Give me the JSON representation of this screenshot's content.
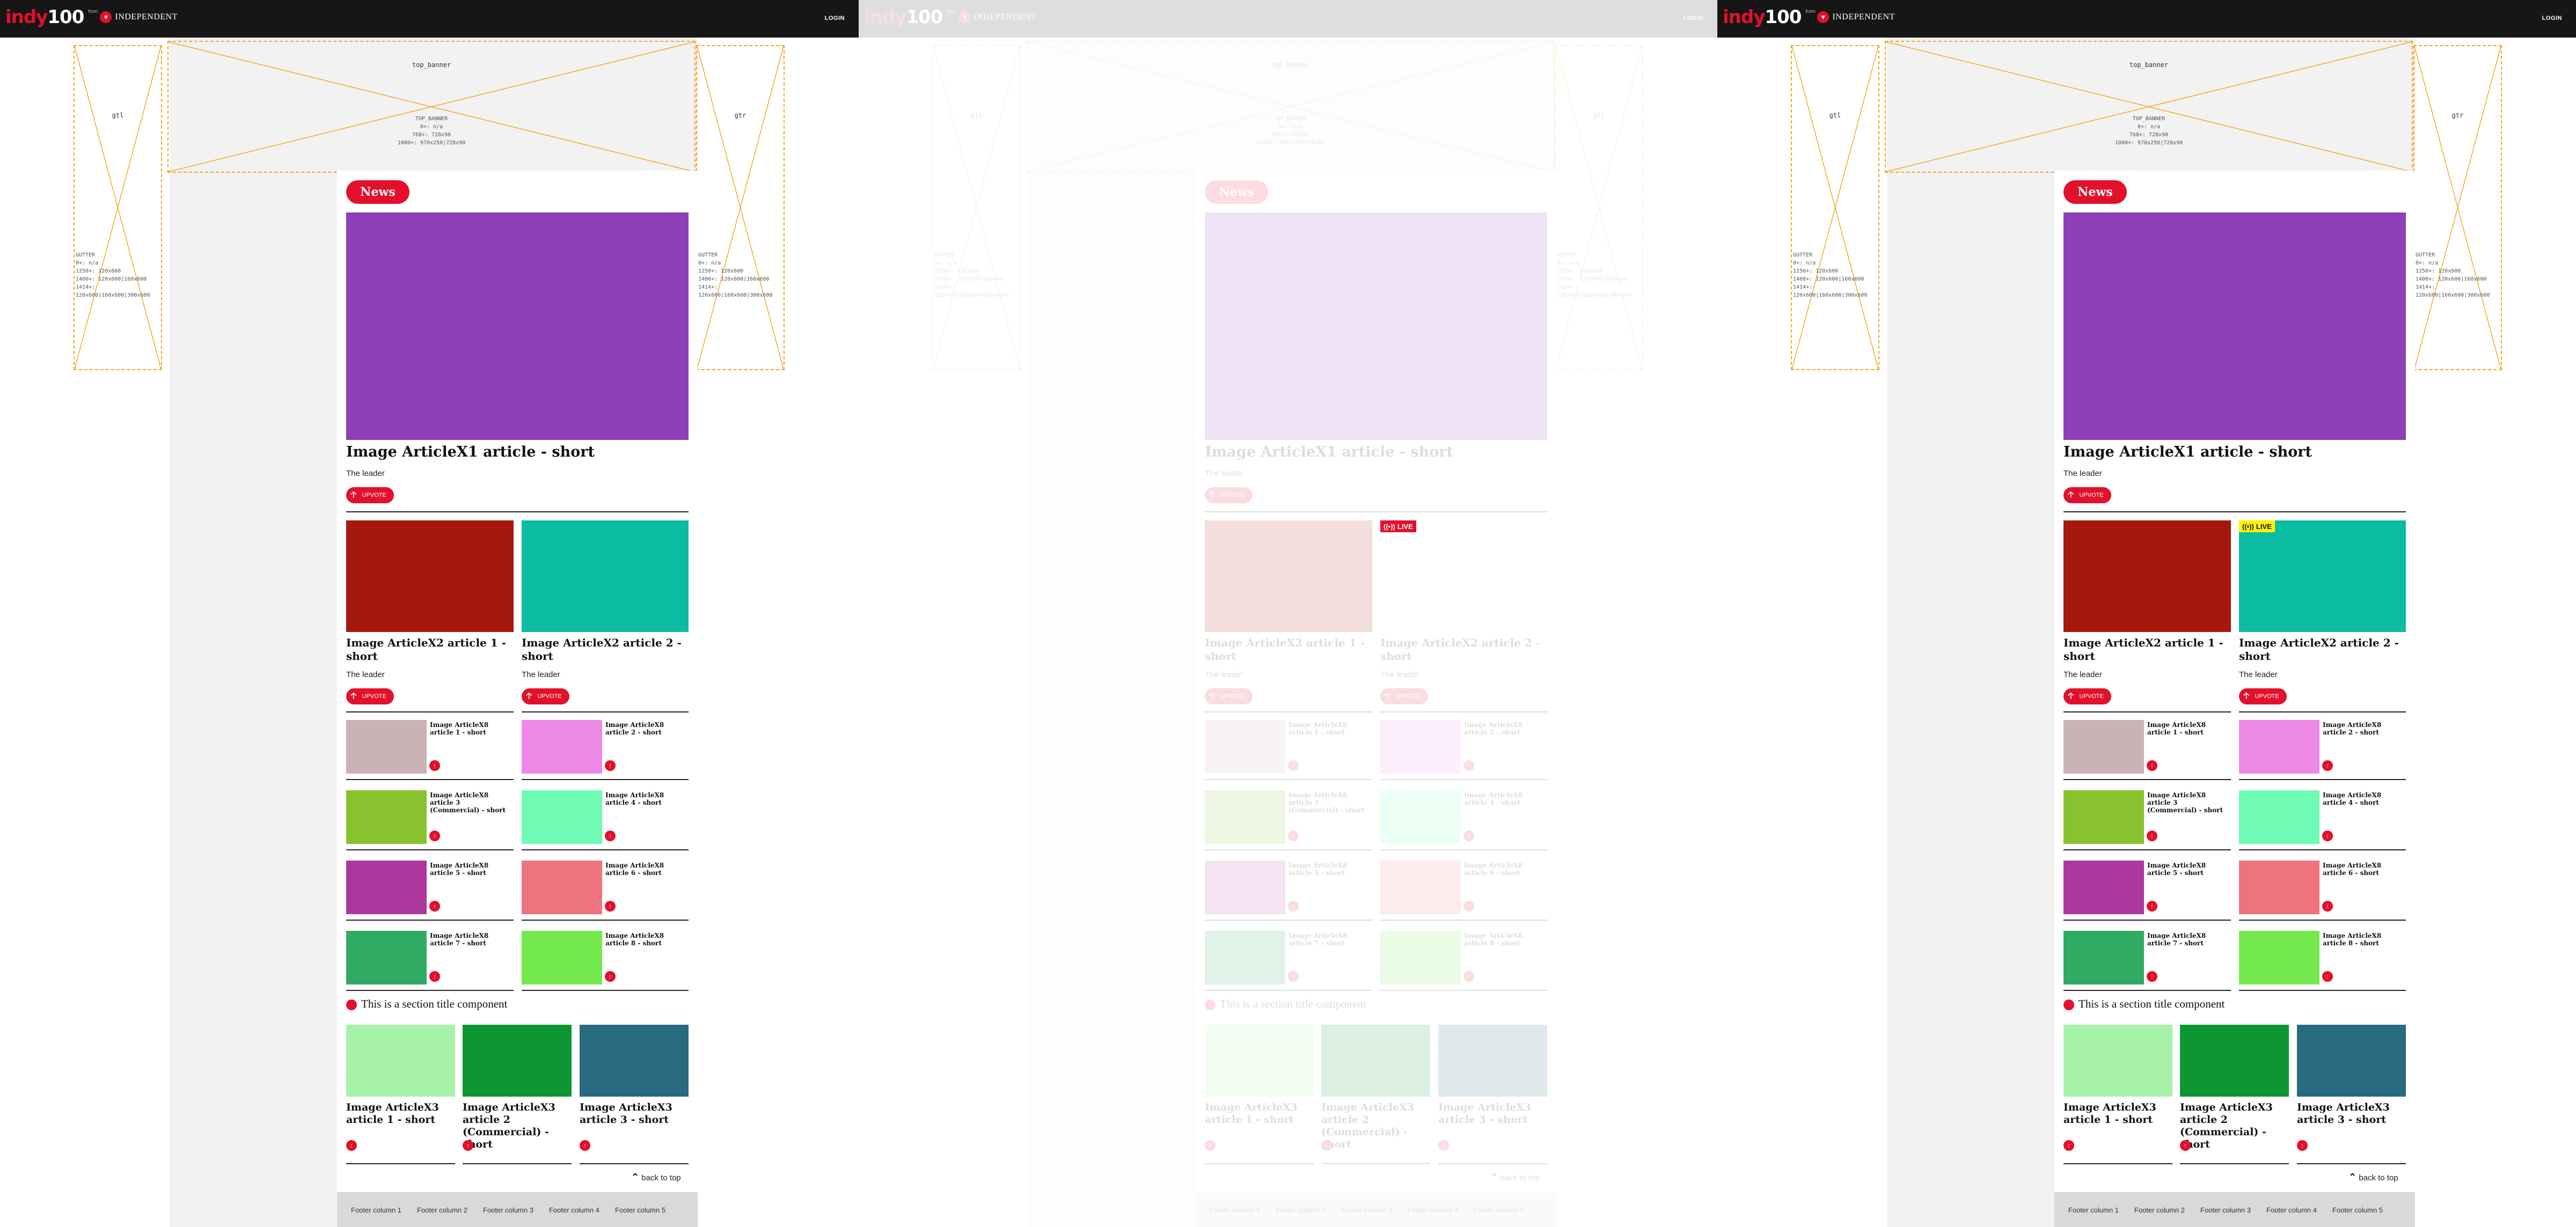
{
  "header": {
    "logo_indy": "indy",
    "logo_num": "100",
    "logo_from": "from",
    "logo_publisher": "INDEPENDENT",
    "login": "LOGIN"
  },
  "ads": {
    "top_banner_label": "top_banner",
    "top_banner_spec_1": "TOP_BANNER",
    "top_banner_spec_2": "0+: n/a",
    "top_banner_spec_3": "768+: 728x90",
    "top_banner_spec_4": "1000+: 970x250|728x90",
    "gutter_left_label": "gtl",
    "gutter_right_label": "gtr",
    "gutter_spec_1": "GUTTER",
    "gutter_spec_2": "0+: n/a",
    "gutter_spec_3": "1250+: 120x600",
    "gutter_spec_4": "1400+: 120x600|160x600",
    "gutter_spec_5": "1414+:",
    "gutter_spec_6": "120x600|160x600|300x600"
  },
  "section": {
    "pill": "News",
    "title": "This is a section title component",
    "back_to_top": "back to top"
  },
  "upvote_label": "UPVOTE",
  "live_label": "LIVE",
  "x1": {
    "title": "Image ArticleX1 article - short",
    "leader": "The leader",
    "color": "#8e3fb6"
  },
  "x2": [
    {
      "title": "Image ArticleX2 article 1 - short",
      "leader": "The leader",
      "color": "#a5180d"
    },
    {
      "title": "Image ArticleX2 article 2 - short",
      "leader": "The leader",
      "color": "#0bbba2"
    }
  ],
  "x8": [
    {
      "title": "Image ArticleX8 article 1 - short",
      "color": "#cab3b5"
    },
    {
      "title": "Image ArticleX8 article 2 - short",
      "color": "#ee88e6"
    },
    {
      "title": "Image ArticleX8 article 3 (Commercial) - short",
      "color": "#88c32f"
    },
    {
      "title": "Image ArticleX8 article 4 - short",
      "color": "#70fbb5"
    },
    {
      "title": "Image ArticleX8 article 5 - short",
      "color": "#ad389d"
    },
    {
      "title": "Image ArticleX8 article 6 - short",
      "color": "#ee737f"
    },
    {
      "title": "Image ArticleX8 article 7 - short",
      "color": "#30ab64"
    },
    {
      "title": "Image ArticleX8 article 8 - short",
      "color": "#73e94d"
    }
  ],
  "x3": [
    {
      "title": "Image ArticleX3 article 1 - short",
      "color": "#a7f3aa"
    },
    {
      "title": "Image ArticleX3 article 2 (Commercial) - short",
      "color": "#0d9631"
    },
    {
      "title": "Image ArticleX3 article 3 - short",
      "color": "#286a80"
    }
  ],
  "footer": [
    "Footer column 1",
    "Footer column 2",
    "Footer column 3",
    "Footer column 4",
    "Footer column 5"
  ]
}
